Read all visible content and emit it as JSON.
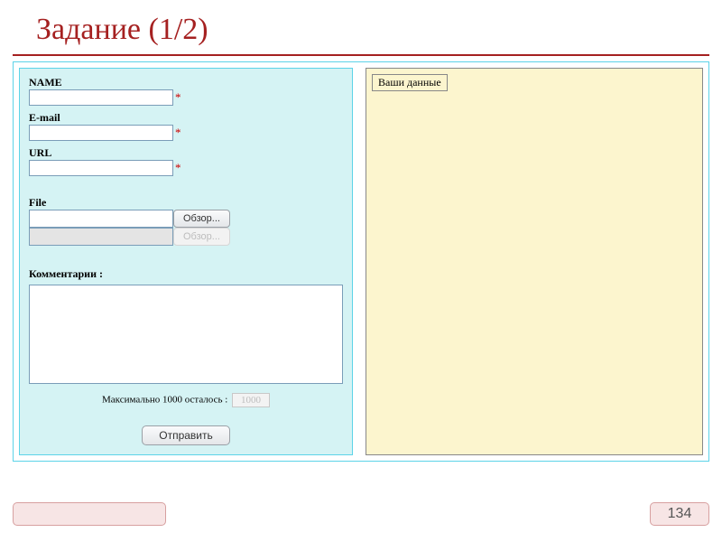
{
  "title": "Задание (1/2)",
  "form": {
    "name": {
      "label": "NAME",
      "value": "",
      "required": "*"
    },
    "email": {
      "label": "E-mail",
      "value": "",
      "required": "*"
    },
    "url": {
      "label": "URL",
      "value": "",
      "required": "*"
    },
    "file": {
      "label": "File",
      "browse1": "Обзор...",
      "browse2": "Обзор..."
    },
    "comments": {
      "label": "Комментарии :",
      "value": ""
    },
    "counter": {
      "prefix": "Максимально 1000 осталось :",
      "value": "1000"
    },
    "submit": "Отправить"
  },
  "output": {
    "legend": "Ваши данные"
  },
  "page_number": "134"
}
